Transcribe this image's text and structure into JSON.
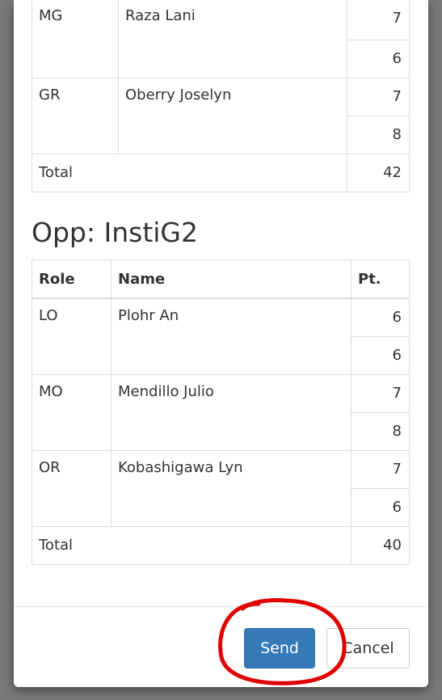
{
  "team1": {
    "rows": [
      {
        "role": "MG",
        "name": "Raza Lani",
        "points": [
          "7",
          "6"
        ]
      },
      {
        "role": "GR",
        "name": "Oberry Joselyn",
        "points": [
          "7",
          "8"
        ]
      }
    ],
    "total_label": "Total",
    "total_value": "42"
  },
  "team2": {
    "title": "Opp: InstiG2",
    "headers": {
      "role": "Role",
      "name": "Name",
      "pt": "Pt."
    },
    "rows": [
      {
        "role": "LO",
        "name": "Plohr An",
        "points": [
          "6",
          "6"
        ]
      },
      {
        "role": "MO",
        "name": "Mendillo Julio",
        "points": [
          "7",
          "8"
        ]
      },
      {
        "role": "OR",
        "name": "Kobashigawa Lyn",
        "points": [
          "7",
          "6"
        ]
      }
    ],
    "total_label": "Total",
    "total_value": "40"
  },
  "footer": {
    "send_label": "Send",
    "cancel_label": "Cancel"
  },
  "colors": {
    "primary": "#337ab7",
    "annotation": "#e00000"
  }
}
